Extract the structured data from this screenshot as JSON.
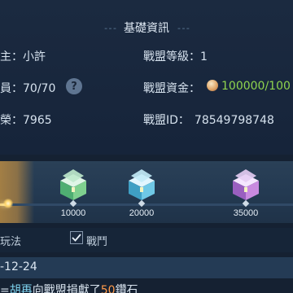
{
  "info": {
    "title": "基礎資訊",
    "leader_label": "主：",
    "leader_value": "小許",
    "level_label": "戰盟等級：",
    "level_value": "1",
    "members_label": "員：",
    "members_value": "70/70",
    "help_icon_glyph": "?",
    "funds_label": "戰盟資金：",
    "funds_value": "100000/100",
    "power_label": "榮：",
    "power_value": "7965",
    "id_label": "戰盟ID：",
    "id_value": "78549798748"
  },
  "rewards": {
    "progress_fraction": 0.03,
    "milestones": [
      {
        "label": "10000",
        "chest_color": "#7fd08f"
      },
      {
        "label": "20000",
        "chest_color": "#6fc8e6"
      },
      {
        "label": "35000",
        "chest_color": "#c98ae0"
      }
    ]
  },
  "tabs": {
    "left_label": "玩法",
    "filter_label": "戰鬥",
    "filter_checked": true
  },
  "log": {
    "date": "-12-24",
    "line_prefix": "=",
    "player_name": "胡再",
    "line_mid": "向戰盟捐獻了",
    "amount": "50",
    "line_suffix": "鑽石"
  },
  "colors": {
    "accent_gold": "#f6d27a",
    "value_green": "#8fd44e",
    "name_cyan": "#7fd4f0",
    "number_orange": "#ff9a4a"
  }
}
